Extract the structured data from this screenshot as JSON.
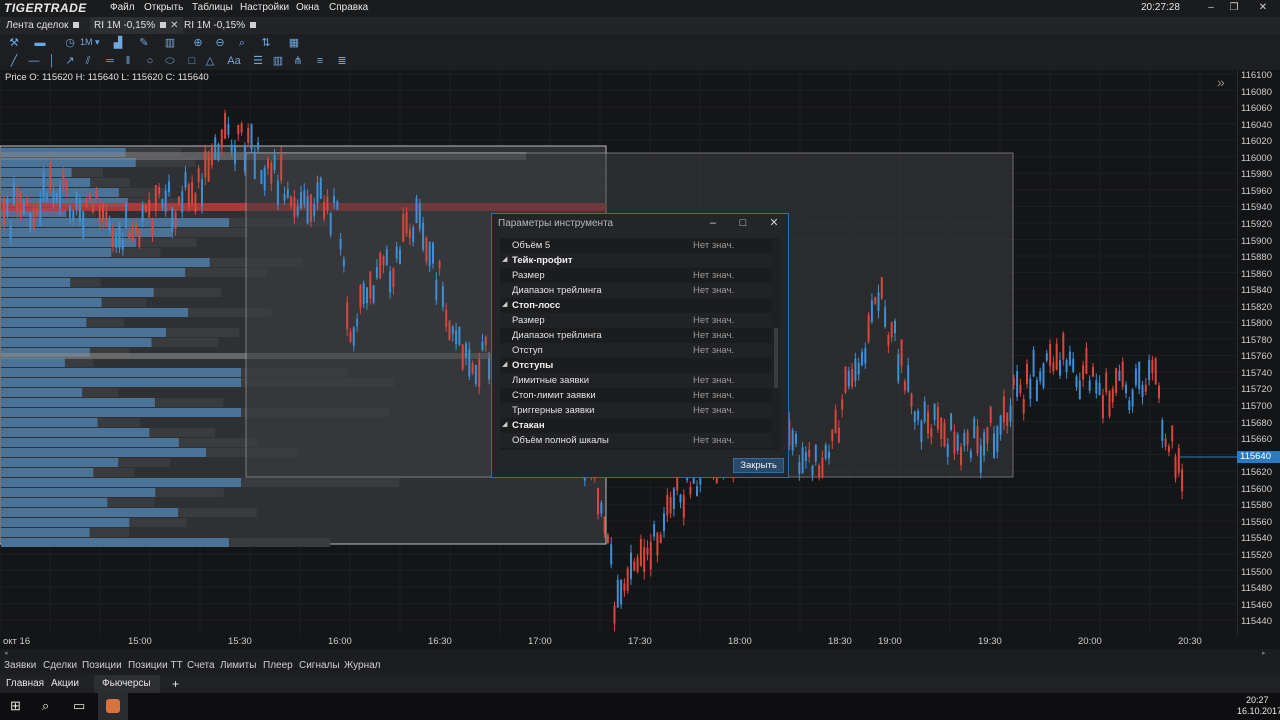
{
  "app": {
    "logo": "TIGERTRADE",
    "menu": [
      "Файл",
      "Открыть",
      "Таблицы",
      "Настройки",
      "Окна",
      "Справка"
    ],
    "clock": "20:27:28"
  },
  "tabs": [
    {
      "label": "Лента сделок"
    },
    {
      "label": "RI 1M -0,15%"
    },
    {
      "label": "RI 1M -0,15%"
    }
  ],
  "chart": {
    "ohlc": "Price O: 115620 H: 115640 L: 115620 C: 115640",
    "current_price": "115640",
    "price_ticks": [
      "116100",
      "116080",
      "116060",
      "116040",
      "116020",
      "116000",
      "115980",
      "115960",
      "115940",
      "115920",
      "115900",
      "115880",
      "115860",
      "115840",
      "115820",
      "115800",
      "115780",
      "115760",
      "115740",
      "115720",
      "115700",
      "115680",
      "115660",
      "115640",
      "115620",
      "115600",
      "115580",
      "115560",
      "115540",
      "115520",
      "115500",
      "115480",
      "115460",
      "115440"
    ],
    "time_ticks": [
      "окт 16",
      "15:00",
      "15:30",
      "16:00",
      "16:30",
      "17:00",
      "17:30",
      "18:00",
      "18:30",
      "19:00",
      "19:30",
      "20:00",
      "20:30"
    ],
    "colors": {
      "up": "#3d8fd6",
      "down": "#d9473d",
      "profile": "#4f7ea8",
      "profile2": "#6a6a6a",
      "hvn": "#c0393a"
    }
  },
  "dialog": {
    "title": "Параметры инструмента",
    "rows": [
      {
        "kind": "item",
        "label": "Объём 5",
        "value": "Нет знач."
      },
      {
        "kind": "group",
        "label": "Тейк-профит"
      },
      {
        "kind": "item",
        "label": "Размер",
        "value": "Нет знач."
      },
      {
        "kind": "item",
        "label": "Диапазон трейлинга",
        "value": "Нет знач."
      },
      {
        "kind": "group",
        "label": "Стоп-лосс"
      },
      {
        "kind": "item",
        "label": "Размер",
        "value": "Нет знач."
      },
      {
        "kind": "item",
        "label": "Диапазон трейлинга",
        "value": "Нет знач."
      },
      {
        "kind": "item",
        "label": "Отступ",
        "value": "Нет знач."
      },
      {
        "kind": "group",
        "label": "Отступы"
      },
      {
        "kind": "item",
        "label": "Лимитные заявки",
        "value": "Нет знач."
      },
      {
        "kind": "item",
        "label": "Стоп-лимит заявки",
        "value": "Нет знач."
      },
      {
        "kind": "item",
        "label": "Триггерные заявки",
        "value": "Нет знач."
      },
      {
        "kind": "group",
        "label": "Стакан"
      },
      {
        "kind": "item",
        "label": "Объём полной шкалы",
        "value": "Нет знач."
      }
    ],
    "close_label": "Закрыть"
  },
  "bottom_tabs": [
    "Заявки",
    "Сделки",
    "Позиции",
    "Позиции ТТ",
    "Счета",
    "Лимиты",
    "Плеер",
    "Сигналы",
    "Журнал"
  ],
  "workspaces": [
    "Главная",
    "Акции",
    "Фьючерсы",
    "+"
  ],
  "taskbar": {
    "time": "20:27",
    "date": "16.10.2017"
  }
}
